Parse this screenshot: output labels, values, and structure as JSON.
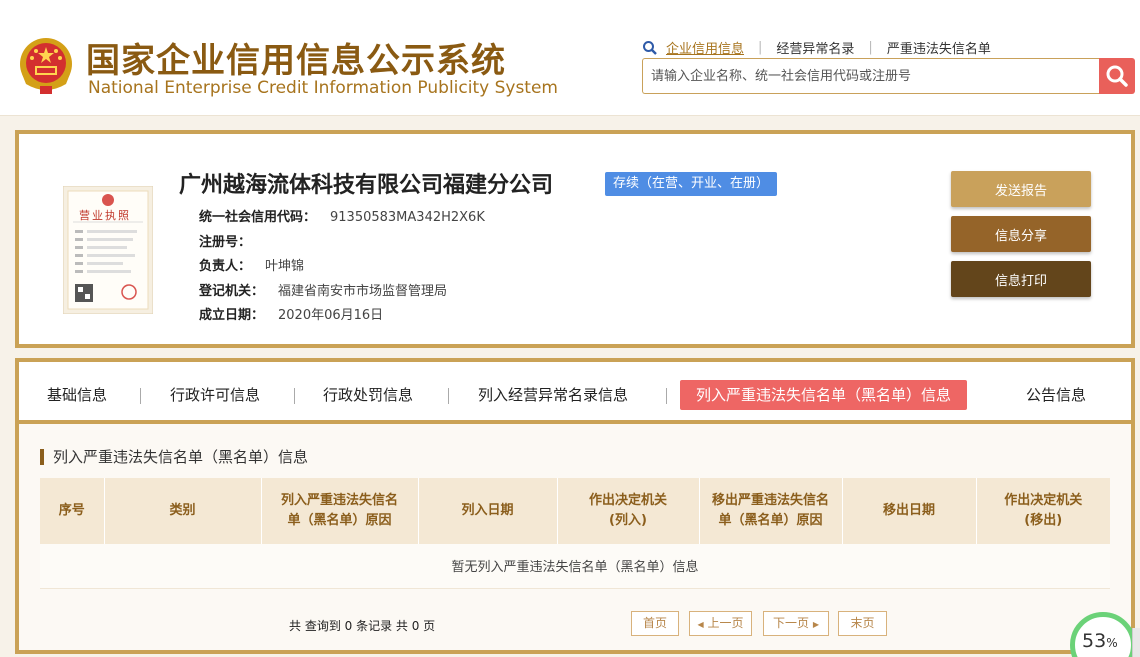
{
  "header": {
    "logo_cn": "国家企业信用信息公示系统",
    "logo_en": "National Enterprise Credit Information Publicity System",
    "top_links": [
      "企业信用信息",
      "经营异常名录",
      "严重违法失信名单"
    ],
    "search_placeholder": "请输入企业名称、统一社会信用代码或注册号"
  },
  "company": {
    "name": "广州越海流体科技有限公司福建分公司",
    "status": "存续（在营、开业、在册）",
    "fields": [
      {
        "label": "统一社会信用代码：",
        "value": "91350583MA342H2X6K"
      },
      {
        "label": "注册号：",
        "value": ""
      },
      {
        "label": "负责人：",
        "value": "叶坤锦"
      },
      {
        "label": "登记机关：",
        "value": "福建省南安市市场监督管理局"
      },
      {
        "label": "成立日期：",
        "value": "2020年06月16日"
      }
    ],
    "license_title": "营业执照"
  },
  "actions": [
    "发送报告",
    "信息分享",
    "信息打印"
  ],
  "tabs": [
    "基础信息",
    "行政许可信息",
    "行政处罚信息",
    "列入经营异常名录信息",
    "列入严重违法失信名单（黑名单）信息",
    "公告信息"
  ],
  "section": {
    "title": "列入严重违法失信名单（黑名单）信息",
    "columns": [
      [
        "序号"
      ],
      [
        "类别"
      ],
      [
        "列入严重违法失信名",
        "单（黑名单）原因"
      ],
      [
        "列入日期"
      ],
      [
        "作出决定机关",
        "(列入)"
      ],
      [
        "移出严重违法失信名",
        "单（黑名单）原因"
      ],
      [
        "移出日期"
      ],
      [
        "作出决定机关",
        "(移出)"
      ]
    ],
    "empty_text": "暂无列入严重违法失信名单（黑名单）信息"
  },
  "pagination": {
    "records": "共 查询到 0 条记录 共 0 页",
    "first": "首页",
    "prev": "上一页",
    "next": "下一页",
    "last": "末页"
  },
  "loader": {
    "value": "53",
    "unit": "%"
  },
  "colors": {
    "gold": "#caa256",
    "brown": "#8a5a12",
    "active_tab": "#ee6664",
    "badge_blue": "#4f8de4",
    "btn_send": "#c9a15b",
    "btn_share": "#956429",
    "btn_print": "#63451b"
  }
}
